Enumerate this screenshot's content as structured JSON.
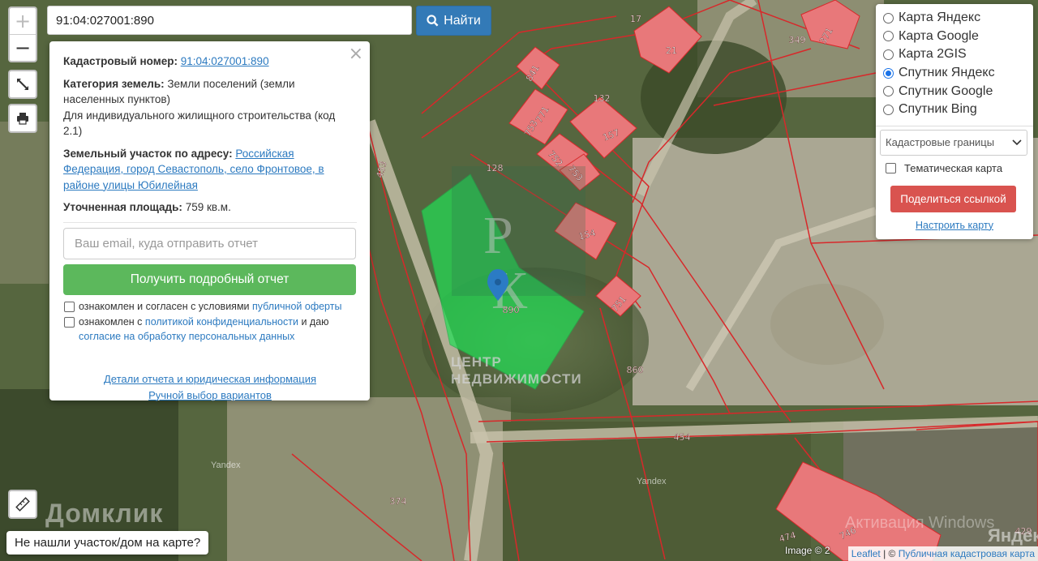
{
  "search": {
    "value": "91:04:027001:890",
    "button_label": "Найти"
  },
  "zoom": {
    "in_label": "+",
    "out_label": "−"
  },
  "popup": {
    "close_label": "×",
    "cadastral_label": "Кадастровый номер:",
    "cadastral_value": "91:04:027001:890",
    "category_label": "Категория земель:",
    "category_value": "Земли поселений (земли населенных пунктов)",
    "usage_value": "Для индивидуального жилищного строительства (код 2.1)",
    "address_label": "Земельный участок по адресу:",
    "address_value": "Российская Федерация, город Севастополь, село Фронтовое, в районе улицы Юбилейная",
    "area_label": "Уточненная площадь:",
    "area_value": "759 кв.м.",
    "email_placeholder": "Ваш email, куда отправить отчет",
    "report_button": "Получить подробный отчет",
    "consent1_text": "ознакомлен и согласен с условиями",
    "consent1_link": "публичной оферты",
    "consent2_text_a": "ознакомлен с",
    "consent2_link_a": "политикой конфиденциальности",
    "consent2_text_b": "и даю",
    "consent2_link_b": "согласие на обработку персональных данных",
    "details_link": "Детали отчета и юридическая информация",
    "manual_link": "Ручной выбор вариантов"
  },
  "layers": {
    "options": [
      {
        "label": "Карта Яндекс",
        "selected": false
      },
      {
        "label": "Карта Google",
        "selected": false
      },
      {
        "label": "Карта 2GIS",
        "selected": false
      },
      {
        "label": "Спутник Яндекс",
        "selected": true
      },
      {
        "label": "Спутник Google",
        "selected": false
      },
      {
        "label": "Спутник Bing",
        "selected": false
      }
    ],
    "select_value": "Кадастровые границы",
    "thematic_label": "Тематическая карта",
    "share_button": "Поделиться ссылкой",
    "configure_link": "Настроить карту"
  },
  "not_found_button": "Не нашли участок/дом на карте?",
  "attribution": {
    "leaflet": "Leaflet",
    "sep": " | © ",
    "pkk": "Публичная кадастровая карта"
  },
  "image_copy": "Image © 2",
  "watermarks": {
    "brand": "Домклик",
    "center": "ЦЕНТР НЕДВИЖИМОСТИ",
    "windows": "Активация Windows",
    "yandex": "Яндекс",
    "yandex_small": "Yandex",
    "logo_letters": "РК"
  },
  "parcel_labels": [
    "17",
    "21",
    "349",
    "371",
    "841",
    "132",
    "771",
    "753",
    "157",
    "128",
    "752",
    "753",
    "453",
    "154",
    "890",
    "751",
    "860",
    "454",
    "374",
    "474",
    "746",
    "429"
  ],
  "colors": {
    "accent": "#337ab7",
    "report_green": "#5cb85c",
    "share_red": "#d9534f",
    "parcel_fill": "#e8787a",
    "selected_parcel": "#22dd55",
    "boundary": "#d8282a"
  }
}
